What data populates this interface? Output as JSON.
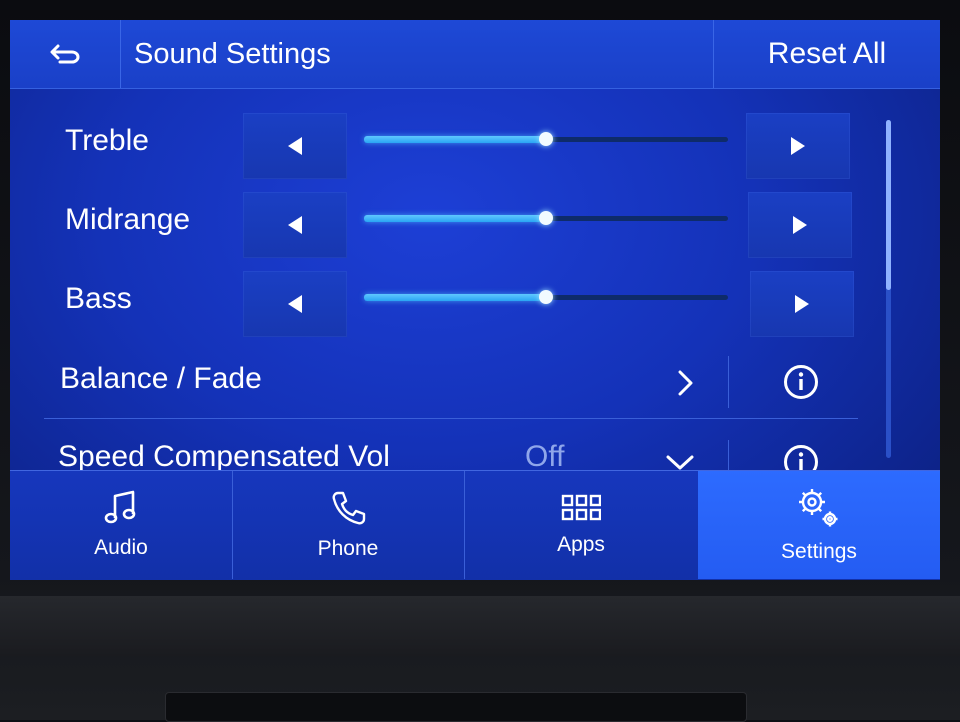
{
  "header": {
    "title": "Sound Settings",
    "reset_label": "Reset All"
  },
  "rows": [
    {
      "label": "Treble",
      "level": 0.5
    },
    {
      "label": "Midrange",
      "level": 0.5
    },
    {
      "label": "Bass",
      "level": 0.5
    }
  ],
  "balance": {
    "label": "Balance / Fade"
  },
  "speed": {
    "label": "Speed Compensated Vol",
    "value": "Off"
  },
  "nav": {
    "items": [
      {
        "label": "Audio",
        "icon": "music-note-icon"
      },
      {
        "label": "Phone",
        "icon": "phone-icon"
      },
      {
        "label": "Apps",
        "icon": "apps-grid-icon"
      },
      {
        "label": "Settings",
        "icon": "gears-icon",
        "active": true
      }
    ]
  },
  "colors": {
    "screen_bg": "#1432b8",
    "accent_fill": "#29a4f4",
    "active_tab": "#2d6bff",
    "text": "#ffffff"
  }
}
